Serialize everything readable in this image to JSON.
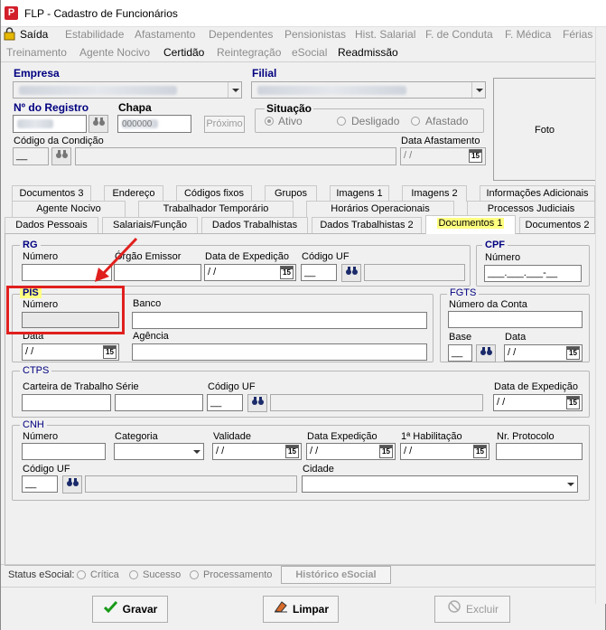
{
  "window": {
    "title": "FLP - Cadastro de Funcionários",
    "icon_letter": "P"
  },
  "menu_row1": [
    "Saída",
    "Estabilidade",
    "Afastamento",
    "Dependentes",
    "Pensionistas",
    "Hist. Salarial",
    "F. de Conduta",
    "F. Médica",
    "Férias"
  ],
  "menu_row2": [
    "Treinamento",
    "Agente Nocivo",
    "Certidão",
    "Reintegração",
    "eSocial",
    "Readmissão"
  ],
  "header": {
    "empresa_label": "Empresa",
    "filial_label": "Filial",
    "registro_label": "Nº do Registro",
    "chapa_label": "Chapa",
    "chapa_value": "000000",
    "proximo_label": "Próximo",
    "situacao_label": "Situação",
    "situacao_options": [
      "Ativo",
      "Desligado",
      "Afastado"
    ],
    "codigo_condicao_label": "Código da Condição",
    "codigo_condicao_value": "__",
    "data_afastamento_label": "Data Afastamento",
    "data_afastamento_value": " / /",
    "foto_label": "Foto"
  },
  "tabs_row1": [
    "Documentos 3",
    "Endereço",
    "Códigos fixos",
    "Grupos",
    "Imagens 1",
    "Imagens 2",
    "Informações Adicionais"
  ],
  "tabs_row2": [
    "Agente Nocivo",
    "Trabalhador Temporário",
    "Horários Operacionais",
    "Processos Judiciais"
  ],
  "tabs_row3": [
    "Dados Pessoais",
    "Salariais/Função",
    "Dados Trabalhistas",
    "Dados Trabalhistas 2",
    "Documentos 1",
    "Documentos 2"
  ],
  "rg": {
    "title": "RG",
    "numero": "Número",
    "orgao": "Órgão Emissor",
    "data_exp": "Data de Expedição",
    "data_value": " / /",
    "codigo_uf": "Código UF",
    "uf_value": "__"
  },
  "cpf": {
    "title": "CPF",
    "numero": "Número",
    "value": "___.___.___-__"
  },
  "pis": {
    "title": "PIS",
    "numero": "Número",
    "banco": "Banco",
    "data": "Data",
    "data_value": " / /",
    "agencia": "Agência"
  },
  "fgts": {
    "title": "FGTS",
    "numero_conta": "Número da Conta",
    "base": "Base",
    "base_value": "__",
    "data": "Data",
    "data_value": " / /"
  },
  "ctps": {
    "title": "CTPS",
    "carteira": "Carteira de Trabalho",
    "serie": "Série",
    "codigo_uf": "Código UF",
    "uf_value": "__",
    "data_exp": "Data de Expedição",
    "data_value": " / /"
  },
  "cnh": {
    "title": "CNH",
    "numero": "Número",
    "categoria": "Categoria",
    "validade": "Validade",
    "validade_value": " / /",
    "data_exp": "Data Expedição",
    "data_exp_value": " / /",
    "primeira": "1ª Habilitação",
    "primeira_value": " / /",
    "protocolo": "Nr. Protocolo",
    "codigo_uf": "Código UF",
    "uf_value": "__",
    "cidade": "Cidade"
  },
  "status": {
    "label": "Status eSocial:",
    "options": [
      "Crítica",
      "Sucesso",
      "Processamento"
    ],
    "historico": "Histórico eSocial"
  },
  "buttons": {
    "gravar": "Gravar",
    "limpar": "Limpar",
    "excluir": "Excluir"
  },
  "colors": {
    "accent": "#000080",
    "highlight": "#ffff80",
    "annotation": "#e0201e"
  }
}
